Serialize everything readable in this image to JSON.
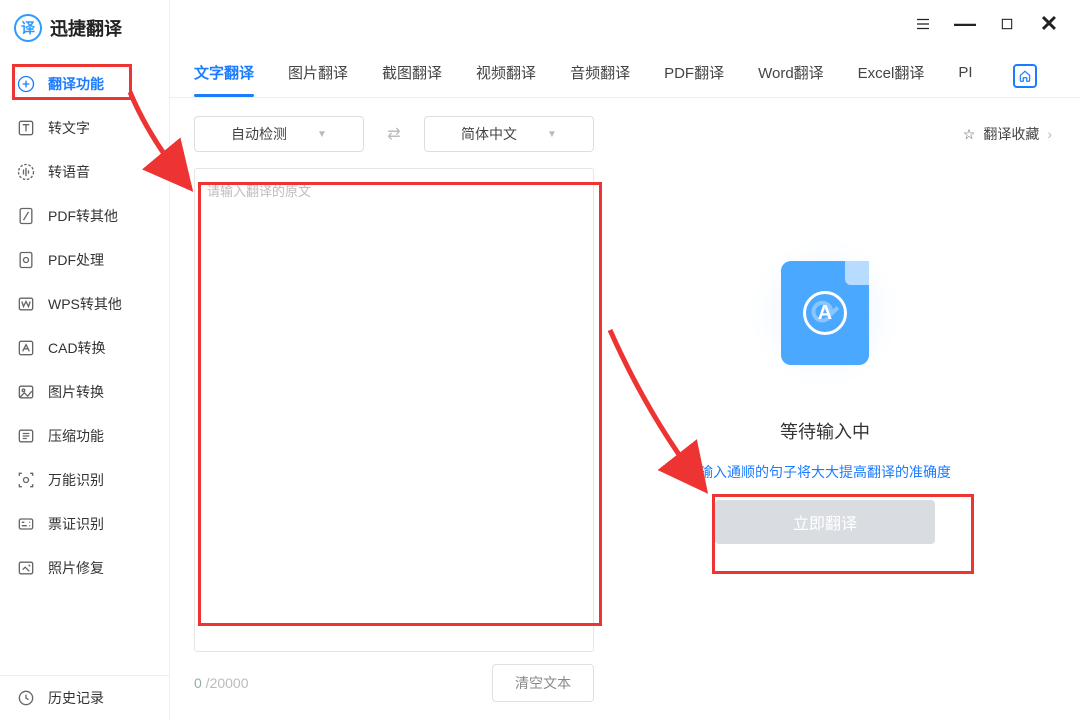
{
  "app": {
    "title": "迅捷翻译"
  },
  "sidebar": {
    "items": [
      {
        "label": "翻译功能"
      },
      {
        "label": "转文字"
      },
      {
        "label": "转语音"
      },
      {
        "label": "PDF转其他"
      },
      {
        "label": "PDF处理"
      },
      {
        "label": "WPS转其他"
      },
      {
        "label": "CAD转换"
      },
      {
        "label": "图片转换"
      },
      {
        "label": "压缩功能"
      },
      {
        "label": "万能识别"
      },
      {
        "label": "票证识别"
      },
      {
        "label": "照片修复"
      }
    ],
    "history_label": "历史记录"
  },
  "tabs": {
    "items": [
      "文字翻译",
      "图片翻译",
      "截图翻译",
      "视频翻译",
      "音频翻译",
      "PDF翻译",
      "Word翻译",
      "Excel翻译",
      "PI"
    ],
    "active_index": 0
  },
  "toolbar": {
    "source_lang": "自动检测",
    "target_lang": "简体中文",
    "favorites_label": "翻译收藏"
  },
  "input": {
    "placeholder": "请输入翻译的原文",
    "value": "",
    "count": "0",
    "max": "20000",
    "clear_label": "清空文本"
  },
  "result": {
    "waiting_label": "等待输入中",
    "hint": "输入通顺的句子将大大提高翻译的准确度",
    "translate_btn": "立即翻译"
  }
}
